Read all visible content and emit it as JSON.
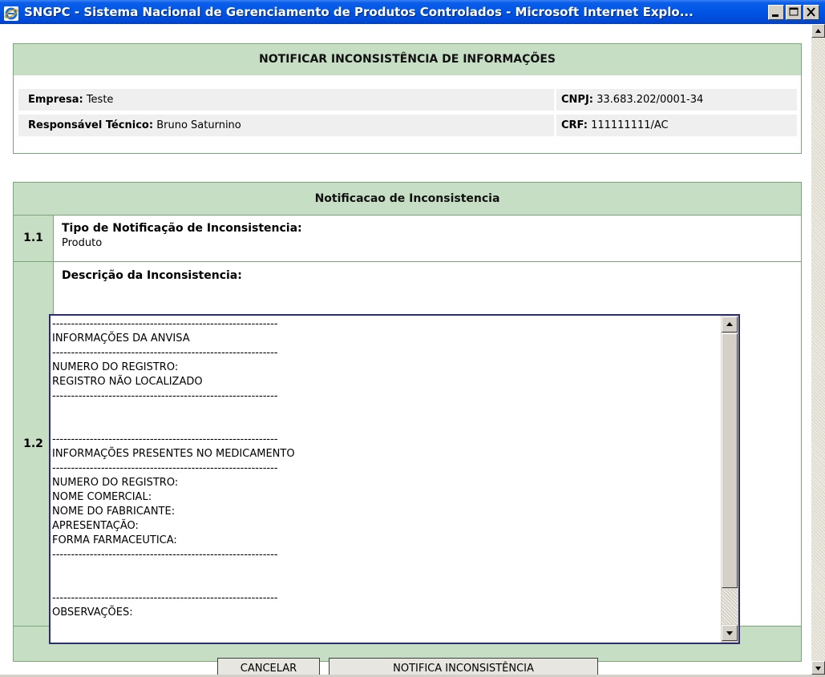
{
  "window": {
    "title": "SNGPC - Sistema Nacional de Gerenciamento de Produtos Controlados - Microsoft Internet Explo..."
  },
  "header": {
    "title": "NOTIFICAR INCONSISTÊNCIA DE INFORMAÇÕES"
  },
  "company": {
    "empresa_label": "Empresa:",
    "empresa_value": "Teste",
    "cnpj_label": "CNPJ:",
    "cnpj_value": "33.683.202/0001-34",
    "responsavel_label": "Responsável Técnico:",
    "responsavel_value": "Bruno Saturnino",
    "crf_label": "CRF:",
    "crf_value": "111111111/AC"
  },
  "notification": {
    "section_title": "Notificacao de Inconsistencia",
    "item1_number": "1.1",
    "item1_label": "Tipo de Notificação de Inconsistencia:",
    "item1_value": "Produto",
    "item2_number": "1.2",
    "item2_label": "Descrição da Inconsistencia:",
    "description_text": "------------------------------------------------------------\nINFORMAÇÕES DA ANVISA\n------------------------------------------------------------\nNUMERO DO REGISTRO:\nREGISTRO NÃO LOCALIZADO\n------------------------------------------------------------\n\n\n------------------------------------------------------------\nINFORMAÇÕES PRESENTES NO MEDICAMENTO\n------------------------------------------------------------\nNUMERO DO REGISTRO:\nNOME COMERCIAL:\nNOME DO FABRICANTE:\nAPRESENTAÇÃO:\nFORMA FARMACEUTICA:\n------------------------------------------------------------\n\n\n------------------------------------------------------------\nOBSERVAÇÕES:"
  },
  "buttons": {
    "cancel_label": "CANCELAR",
    "notify_label": "NOTIFICA INCONSISTÊNCIA"
  },
  "icons": {
    "app_icon": "internet-explorer-icon",
    "minimize": "minimize-icon",
    "maximize": "maximize-icon",
    "close": "close-icon"
  },
  "colors": {
    "titlebar_blue": "#0055e5",
    "header_green": "#c6dec3",
    "border_green": "#7aa77a"
  }
}
